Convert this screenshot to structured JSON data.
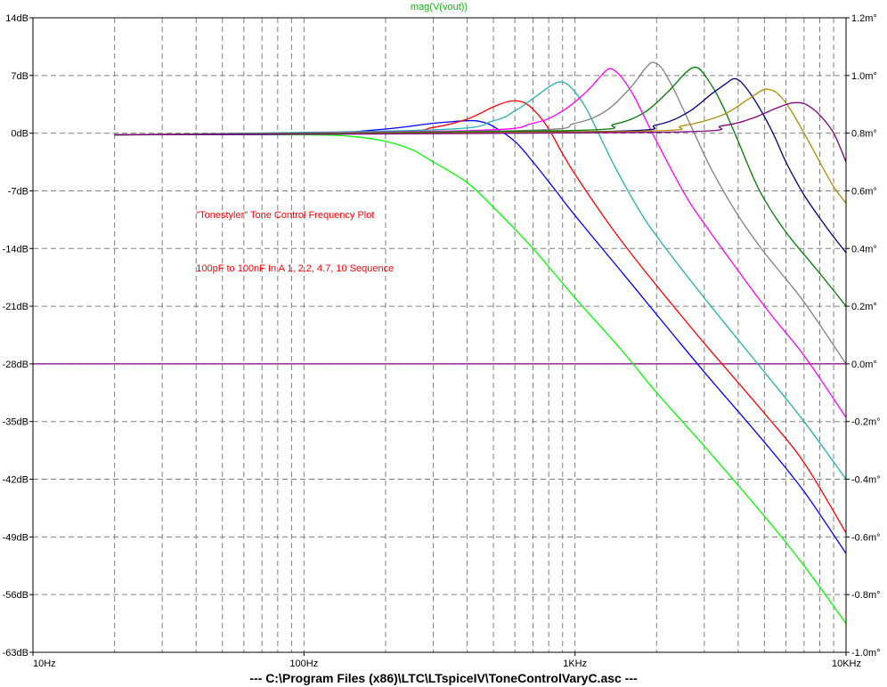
{
  "window": {
    "footer": "---  C:\\Program Files (x86)\\LTC\\LTspiceIV\\ToneControlVaryC.asc  ---"
  },
  "colors": {
    "background": "#ffffff",
    "grid": "#808080",
    "axis": "#000000",
    "trace_title": "#00c000"
  },
  "chart_data": {
    "type": "line",
    "title": "mag(V(vout))",
    "xscale": "log",
    "xlim": [
      10,
      10000
    ],
    "ylim": [
      -63,
      14
    ],
    "y2lim": [
      -1.0,
      1.2
    ],
    "grid": true,
    "x_ticks": [
      {
        "value": 10,
        "label": "10Hz"
      },
      {
        "value": 100,
        "label": "100Hz"
      },
      {
        "value": 1000,
        "label": "1KHz"
      },
      {
        "value": 10000,
        "label": "10KHz"
      }
    ],
    "y_ticks": [
      {
        "value": 14,
        "label": "14dB"
      },
      {
        "value": 7,
        "label": "7dB"
      },
      {
        "value": 0,
        "label": "0dB"
      },
      {
        "value": -7,
        "label": "-7dB"
      },
      {
        "value": -14,
        "label": "-14dB"
      },
      {
        "value": -21,
        "label": "-21dB"
      },
      {
        "value": -28,
        "label": "-28dB"
      },
      {
        "value": -35,
        "label": "-35dB"
      },
      {
        "value": -42,
        "label": "-42dB"
      },
      {
        "value": -49,
        "label": "-49dB"
      },
      {
        "value": -56,
        "label": "-56dB"
      },
      {
        "value": -63,
        "label": "-63dB"
      }
    ],
    "y2_ticks": [
      {
        "value": 1.2,
        "label": "1.2m°"
      },
      {
        "value": 1.0,
        "label": "1.0m°"
      },
      {
        "value": 0.8,
        "label": "0.8m°"
      },
      {
        "value": 0.6,
        "label": "0.6m°"
      },
      {
        "value": 0.4,
        "label": "0.4m°"
      },
      {
        "value": 0.2,
        "label": "0.2m°"
      },
      {
        "value": 0.0,
        "label": "0.0m°"
      },
      {
        "value": -0.2,
        "label": "-0.2m°"
      },
      {
        "value": -0.4,
        "label": "-0.4m°"
      },
      {
        "value": -0.6,
        "label": "-0.6m°"
      },
      {
        "value": -0.8,
        "label": "-0.8m°"
      },
      {
        "value": -1.0,
        "label": "-1.0m°"
      }
    ],
    "annotations": [
      {
        "text": "\"Tonestyler\" Tone Control Frequency Plot",
        "x": 40,
        "y": -10.3
      },
      {
        "text": "100pF to 100nF In A 1, 2.2, 4.7, 10 Sequence",
        "x": 40,
        "y": -16.8
      }
    ],
    "phase_trace": {
      "color": "#800080",
      "value": 0.0
    },
    "series": [
      {
        "color": "#00ff00",
        "points": [
          [
            20,
            -0.2
          ],
          [
            100,
            -0.2
          ],
          [
            150,
            -0.4
          ],
          [
            200,
            -1
          ],
          [
            250,
            -2
          ],
          [
            300,
            -3.5
          ],
          [
            400,
            -6
          ],
          [
            500,
            -9
          ],
          [
            700,
            -14
          ],
          [
            1000,
            -20
          ],
          [
            1500,
            -26.5
          ],
          [
            2000,
            -31.5
          ],
          [
            3000,
            -38
          ],
          [
            5000,
            -46.5
          ],
          [
            7000,
            -52.5
          ],
          [
            10000,
            -59.5
          ]
        ]
      },
      {
        "color": "#0000ff",
        "points": [
          [
            20,
            -0.2
          ],
          [
            100,
            -0.1
          ],
          [
            200,
            0.5
          ],
          [
            300,
            1.2
          ],
          [
            400,
            1.5
          ],
          [
            450,
            1.4
          ],
          [
            500,
            0.8
          ],
          [
            600,
            -1
          ],
          [
            700,
            -3.5
          ],
          [
            850,
            -7
          ],
          [
            1000,
            -10
          ],
          [
            1500,
            -17
          ],
          [
            2000,
            -22
          ],
          [
            3000,
            -29
          ],
          [
            5000,
            -37.5
          ],
          [
            7000,
            -43.5
          ],
          [
            10000,
            -51
          ]
        ]
      },
      {
        "color": "#ff0000",
        "points": [
          [
            20,
            -0.2
          ],
          [
            200,
            0.2
          ],
          [
            300,
            0.7
          ],
          [
            400,
            1.7
          ],
          [
            500,
            3.2
          ],
          [
            580,
            3.9
          ],
          [
            650,
            3.7
          ],
          [
            720,
            2.5
          ],
          [
            800,
            0.5
          ],
          [
            900,
            -2.5
          ],
          [
            1000,
            -5
          ],
          [
            1300,
            -10.5
          ],
          [
            1600,
            -14.5
          ],
          [
            2000,
            -18.5
          ],
          [
            3000,
            -25.5
          ],
          [
            5000,
            -34
          ],
          [
            7000,
            -40
          ],
          [
            10000,
            -48.5
          ]
        ]
      },
      {
        "color": "#20b2b0",
        "points": [
          [
            20,
            -0.2
          ],
          [
            300,
            0.4
          ],
          [
            500,
            1.5
          ],
          [
            600,
            2.7
          ],
          [
            700,
            4.2
          ],
          [
            800,
            5.6
          ],
          [
            870,
            6.2
          ],
          [
            930,
            6
          ],
          [
            1000,
            5
          ],
          [
            1100,
            3
          ],
          [
            1200,
            0.5
          ],
          [
            1400,
            -4
          ],
          [
            1700,
            -9
          ],
          [
            2000,
            -12.5
          ],
          [
            3000,
            -20
          ],
          [
            5000,
            -29
          ],
          [
            7000,
            -35
          ],
          [
            10000,
            -42
          ]
        ]
      },
      {
        "color": "#ff00ff",
        "points": [
          [
            20,
            -0.2
          ],
          [
            400,
            0.3
          ],
          [
            700,
            1.2
          ],
          [
            900,
            2.7
          ],
          [
            1100,
            5
          ],
          [
            1250,
            7
          ],
          [
            1330,
            7.8
          ],
          [
            1400,
            7.6
          ],
          [
            1500,
            6.6
          ],
          [
            1650,
            4.5
          ],
          [
            1800,
            2
          ],
          [
            2000,
            -1
          ],
          [
            2500,
            -7
          ],
          [
            3000,
            -11
          ],
          [
            5000,
            -21
          ],
          [
            7000,
            -27
          ],
          [
            10000,
            -34.5
          ]
        ]
      },
      {
        "color": "#808080",
        "points": [
          [
            20,
            -0.2
          ],
          [
            600,
            0.3
          ],
          [
            1000,
            1.2
          ],
          [
            1300,
            2.7
          ],
          [
            1600,
            5.5
          ],
          [
            1800,
            7.7
          ],
          [
            1900,
            8.5
          ],
          [
            1980,
            8.5
          ],
          [
            2100,
            7.8
          ],
          [
            2300,
            5.5
          ],
          [
            2500,
            3
          ],
          [
            2800,
            -0.5
          ],
          [
            3200,
            -4.5
          ],
          [
            4000,
            -10
          ],
          [
            5000,
            -14.5
          ],
          [
            7000,
            -20.5
          ],
          [
            10000,
            -28
          ]
        ]
      },
      {
        "color": "#007a00",
        "points": [
          [
            20,
            -0.2
          ],
          [
            900,
            0.3
          ],
          [
            1400,
            1.1
          ],
          [
            1800,
            2.5
          ],
          [
            2200,
            5
          ],
          [
            2500,
            7
          ],
          [
            2700,
            7.9
          ],
          [
            2850,
            7.9
          ],
          [
            3000,
            7.1
          ],
          [
            3300,
            5
          ],
          [
            3600,
            2.5
          ],
          [
            4000,
            -1
          ],
          [
            4800,
            -7
          ],
          [
            6000,
            -12
          ],
          [
            8000,
            -17
          ],
          [
            10000,
            -21
          ]
        ]
      },
      {
        "color": "#000080",
        "points": [
          [
            20,
            -0.2
          ],
          [
            1200,
            0.2
          ],
          [
            2000,
            1
          ],
          [
            2600,
            2.5
          ],
          [
            3200,
            4.8
          ],
          [
            3600,
            6
          ],
          [
            3850,
            6.6
          ],
          [
            4100,
            6.2
          ],
          [
            4500,
            4.5
          ],
          [
            5000,
            2
          ],
          [
            5500,
            -0.7
          ],
          [
            6000,
            -3.5
          ],
          [
            7000,
            -7.5
          ],
          [
            8500,
            -11.5
          ],
          [
            10000,
            -14.5
          ]
        ]
      },
      {
        "color": "#b08800",
        "points": [
          [
            20,
            -0.2
          ],
          [
            1500,
            0.2
          ],
          [
            2500,
            0.9
          ],
          [
            3500,
            2.2
          ],
          [
            4300,
            4
          ],
          [
            4900,
            5.2
          ],
          [
            5200,
            5.3
          ],
          [
            5600,
            4.8
          ],
          [
            6200,
            3
          ],
          [
            7000,
            0
          ],
          [
            8000,
            -3.5
          ],
          [
            9000,
            -6.5
          ],
          [
            10000,
            -8.5
          ]
        ]
      },
      {
        "color": "#800080",
        "points": [
          [
            20,
            -0.2
          ],
          [
            2000,
            0.1
          ],
          [
            3500,
            0.9
          ],
          [
            4500,
            1.8
          ],
          [
            5500,
            3
          ],
          [
            6200,
            3.6
          ],
          [
            6700,
            3.7
          ],
          [
            7200,
            3.4
          ],
          [
            8000,
            2.2
          ],
          [
            9000,
            0
          ],
          [
            10000,
            -3.5
          ]
        ]
      }
    ]
  }
}
